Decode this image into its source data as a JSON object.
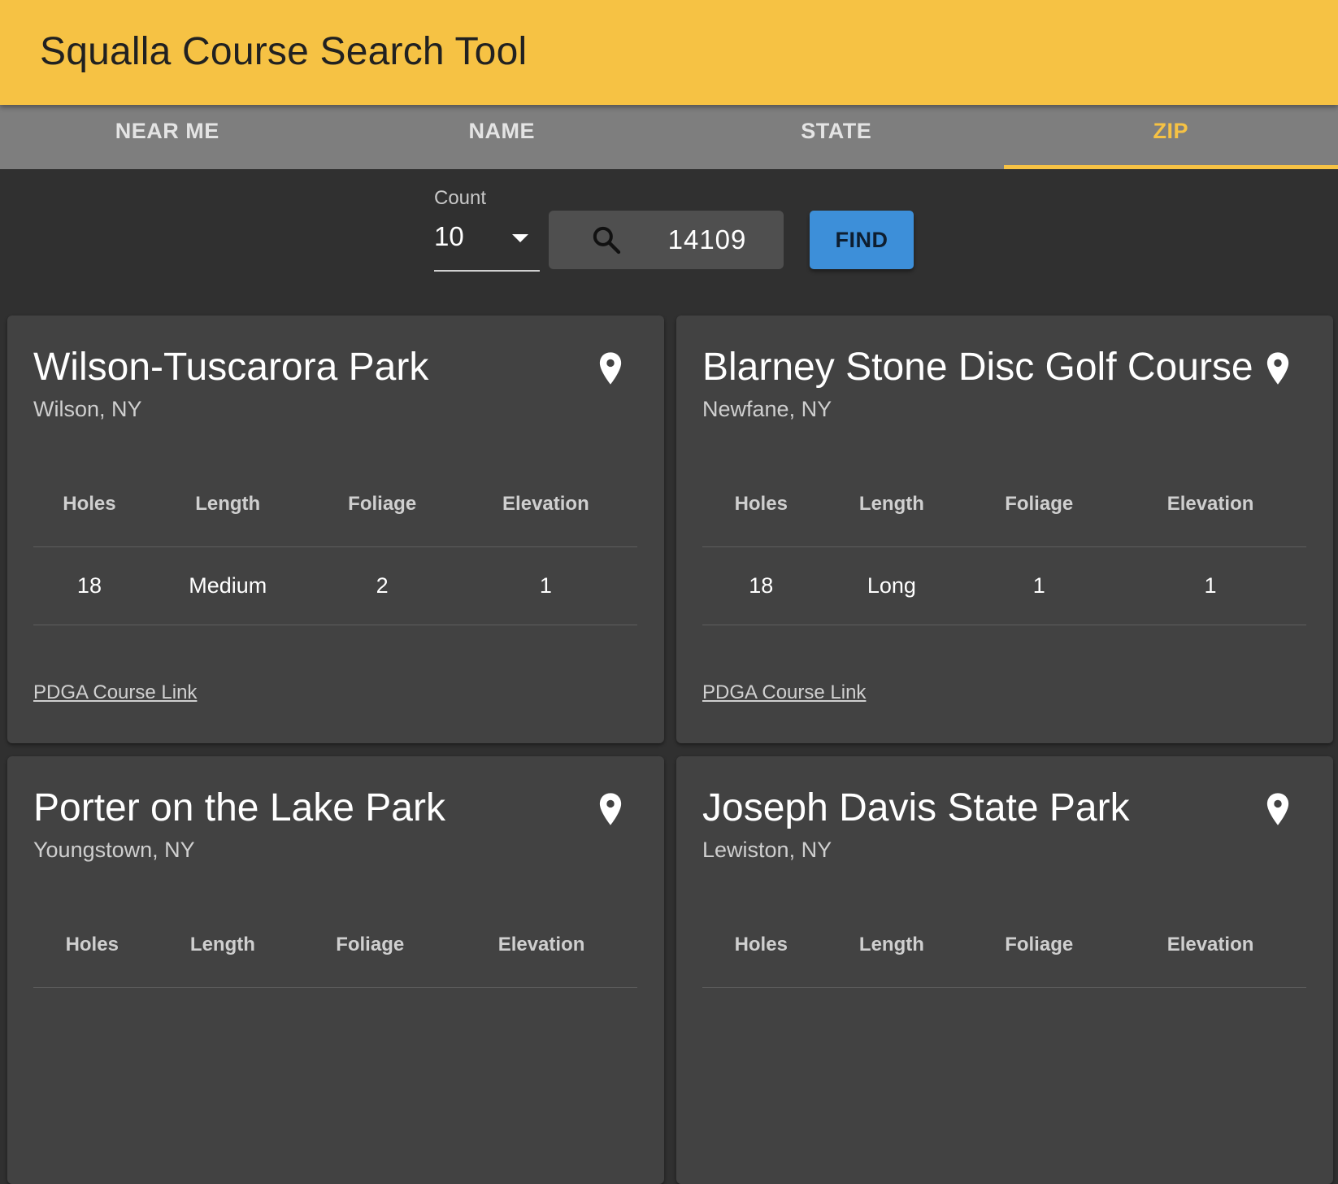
{
  "app": {
    "title": "Squalla Course Search Tool"
  },
  "tabs": [
    {
      "label": "NEAR ME",
      "active": false
    },
    {
      "label": "NAME",
      "active": false
    },
    {
      "label": "STATE",
      "active": false
    },
    {
      "label": "ZIP",
      "active": true
    }
  ],
  "search": {
    "count_label": "Count",
    "count_value": "10",
    "zip_value": "14109",
    "find_label": "FIND"
  },
  "table_headers": [
    "Holes",
    "Length",
    "Foliage",
    "Elevation"
  ],
  "courses": [
    {
      "name": "Wilson-Tuscarora Park",
      "location": "Wilson, NY",
      "holes": "18",
      "length": "Medium",
      "foliage": "2",
      "elevation": "1",
      "link_label": "PDGA Course Link"
    },
    {
      "name": "Blarney Stone Disc Golf Course",
      "location": "Newfane, NY",
      "holes": "18",
      "length": "Long",
      "foliage": "1",
      "elevation": "1",
      "link_label": "PDGA Course Link"
    },
    {
      "name": "Porter on the Lake Park",
      "location": "Youngstown, NY"
    },
    {
      "name": "Joseph Davis State Park",
      "location": "Lewiston, NY"
    }
  ],
  "colors": {
    "accent": "#f6c244",
    "tab_bar": "#7e7e7e",
    "background": "#303030",
    "card": "#424242",
    "find_button": "#3d8fd9"
  },
  "icons": {
    "search": "search-icon",
    "location": "location-pin-icon",
    "dropdown": "caret-down-icon"
  }
}
